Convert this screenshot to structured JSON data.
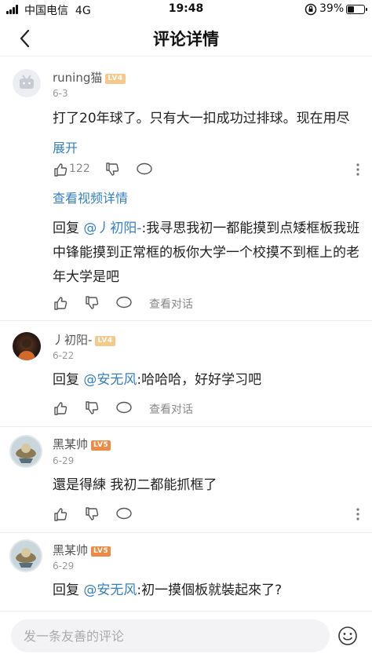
{
  "status": {
    "carrier": "中国电信",
    "network": "4G",
    "time": "19:48",
    "battery": "39%"
  },
  "header": {
    "title": "评论详情"
  },
  "main_comment": {
    "user": "runing猫",
    "level": "LV4",
    "date": "6-3",
    "text": "打了20年球了。只有大一扣成功过排球。现在用尽",
    "expand": "展开",
    "likes": "122",
    "view_video": "查看视频详情"
  },
  "replies": [
    {
      "text_prefix": "回复 ",
      "mention": "@丿初阳-",
      "text": ":我寻思我初一都能摸到点矮框板我班中锋能摸到正常框的板你大学一个校摸不到框上的老年大学是吧",
      "view_dialog": "查看对话"
    },
    {
      "user": "丿初阳-",
      "level": "LV4",
      "date": "6-22",
      "text_prefix": "回复 ",
      "mention": "@安无风",
      "text": ":哈哈哈，好好学习吧",
      "view_dialog": "查看对话"
    },
    {
      "user": "黑某帅",
      "level": "LV5",
      "date": "6-29",
      "text": "還是得練 我初二都能抓框了"
    },
    {
      "user": "黑某帅",
      "level": "LV5",
      "date": "6-29",
      "text_prefix": "回复 ",
      "mention": "@安无风",
      "text": ":初一摸個板就裝起來了?"
    }
  ],
  "bottom": {
    "placeholder": "发一条友善的评论"
  }
}
